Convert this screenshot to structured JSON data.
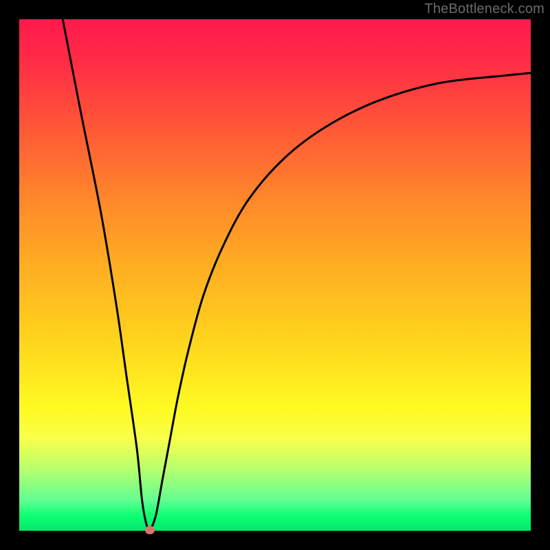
{
  "watermark": "TheBottleneck.com",
  "chart_data": {
    "type": "line",
    "title": "",
    "xlabel": "",
    "ylabel": "",
    "xlim": [
      0,
      100
    ],
    "ylim": [
      0,
      100
    ],
    "grid": false,
    "note": "Axes have no tick labels in the source image; values are percentage coordinates inferred from the plot area.",
    "series": [
      {
        "name": "bottleneck-curve",
        "x": [
          8.5,
          12,
          16,
          19,
          21,
          23,
          24,
          24.8,
          25.5,
          26.7,
          28,
          29.5,
          31,
          33,
          36,
          40,
          45,
          52,
          60,
          70,
          82,
          95,
          100
        ],
        "y": [
          100,
          82,
          62,
          44,
          30,
          16,
          6,
          1.5,
          0.2,
          3,
          10,
          18,
          26,
          35,
          46,
          56,
          65,
          73,
          79,
          84,
          87.5,
          89,
          89.5
        ],
        "color": "#000000"
      }
    ],
    "annotations": [
      {
        "name": "min-marker",
        "x": 25.5,
        "y": 0.2,
        "color": "#d8766b"
      }
    ]
  }
}
